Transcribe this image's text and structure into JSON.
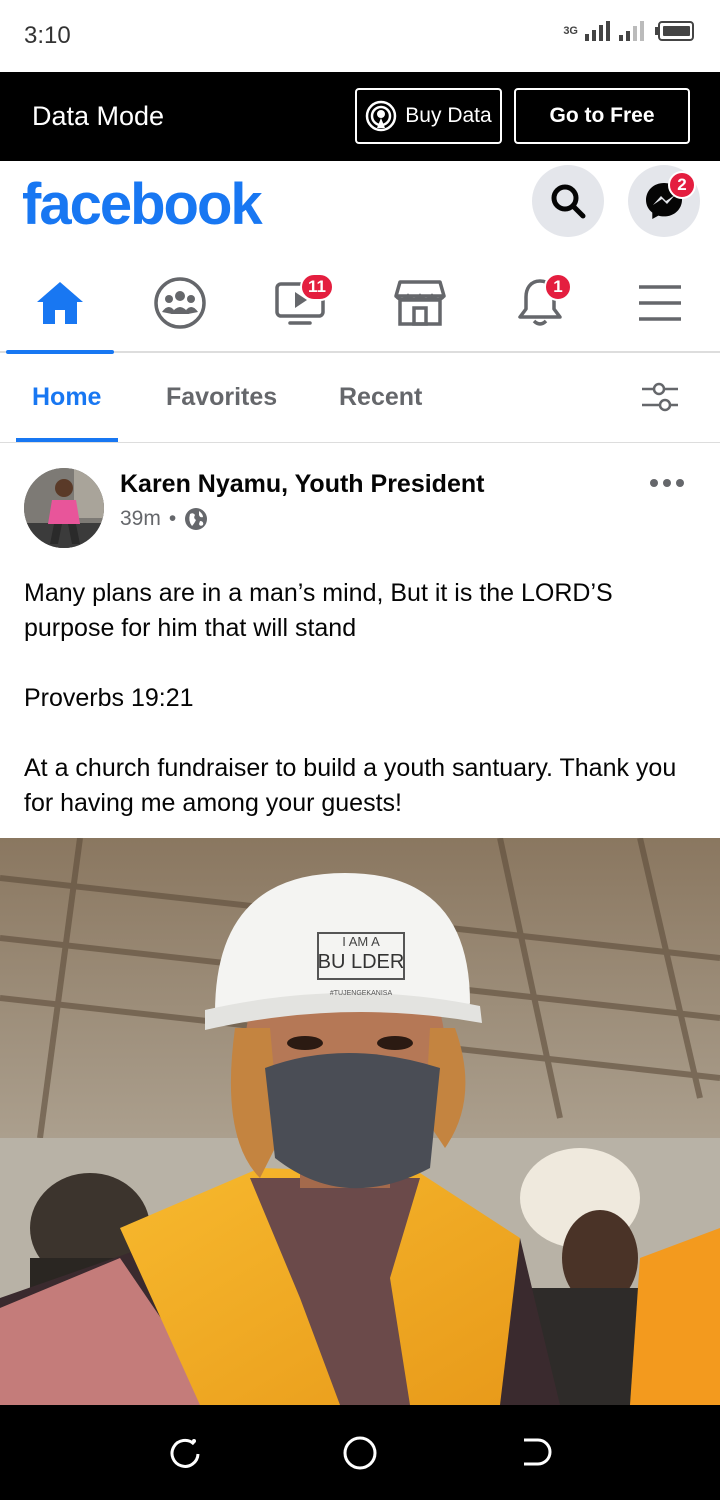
{
  "status_bar": {
    "time": "3:10",
    "network": "3G"
  },
  "data_bar": {
    "mode_label": "Data Mode",
    "buy_data_label": "Buy Data",
    "go_free_label": "Go to Free"
  },
  "header": {
    "logo": "facebook",
    "messenger_badge": "2"
  },
  "nav": {
    "items": [
      {
        "name": "home",
        "active": true
      },
      {
        "name": "groups"
      },
      {
        "name": "watch",
        "badge": "11"
      },
      {
        "name": "marketplace"
      },
      {
        "name": "notifications",
        "badge": "1"
      },
      {
        "name": "menu"
      }
    ]
  },
  "feed_tabs": {
    "tabs": [
      {
        "label": "Home",
        "active": true
      },
      {
        "label": "Favorites"
      },
      {
        "label": "Recent"
      }
    ]
  },
  "post": {
    "author": "Karen Nyamu, Youth President",
    "time": "39m",
    "paragraphs": [
      "Many plans are in a man’s mind, But it is the LORD’S purpose for him that will stand",
      "",
      "Proverbs 19:21",
      "",
      "At a church fundraiser to build a youth santuary. Thank you for having me among your guests!"
    ],
    "photo": {
      "helmet_line1": "I AM A",
      "helmet_line2": "BU LDER",
      "helmet_line3": "#TUJENGEKANISA"
    }
  },
  "colors": {
    "brand": "#1877f2",
    "badge": "#e41e3f",
    "vest": "#f5a623"
  }
}
